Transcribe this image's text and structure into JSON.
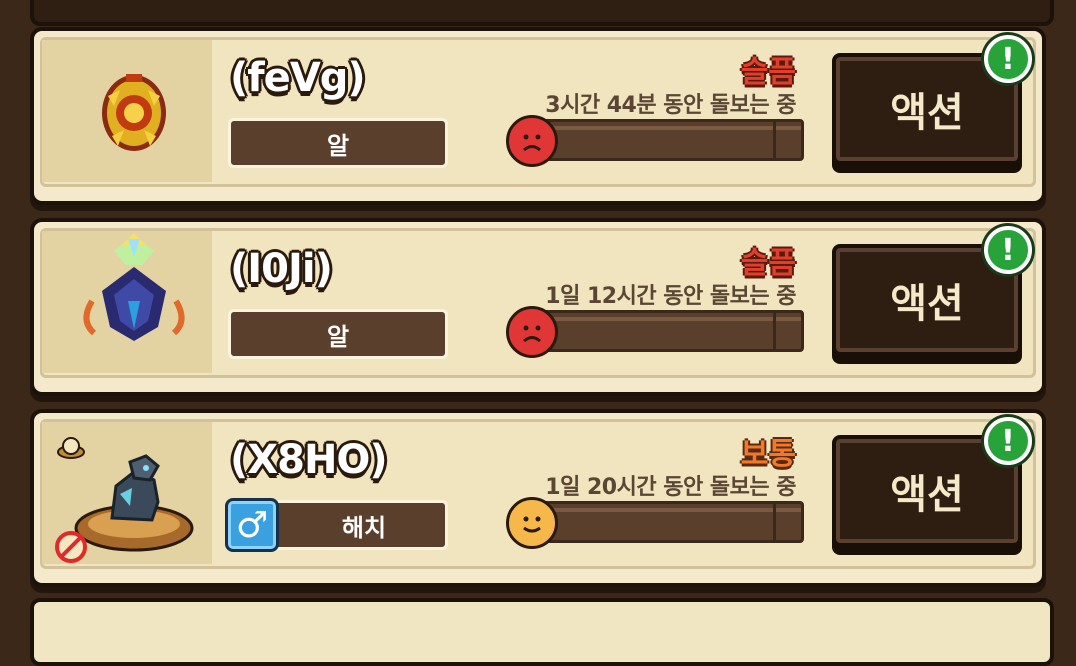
{
  "colors": {
    "background": "#3b2818",
    "card": "#f4eacb",
    "icon_panel": "#e3d3a2",
    "sad": "#e03636",
    "normal": "#f07a2a",
    "badge_green": "#27a33a"
  },
  "pets": [
    {
      "name": "(feVg)",
      "stage": "알",
      "mood": "슬픔",
      "mood_face": "sad-face-icon",
      "care_time": "3시간 44분 동안 돌보는 중",
      "mood_fill": 0,
      "action_label": "액션",
      "badge": "!",
      "icon": "golden-egg-icon"
    },
    {
      "name": "(I0Ji)",
      "stage": "알",
      "mood": "슬픔",
      "mood_face": "sad-face-icon",
      "care_time": "1일 12시간 동안 돌보는 중",
      "mood_fill": 0,
      "action_label": "액션",
      "badge": "!",
      "icon": "crystal-creature-icon"
    },
    {
      "name": "(X8HO)",
      "stage": "해치",
      "gender": "♂",
      "gender_icon": "male-icon",
      "mood": "보통",
      "mood_face": "neutral-face-icon",
      "care_time": "1일 20시간 동안 돌보는 중",
      "mood_fill": 0.08,
      "action_label": "액션",
      "badge": "!",
      "icon": "baby-dragon-in-nest-icon"
    }
  ]
}
